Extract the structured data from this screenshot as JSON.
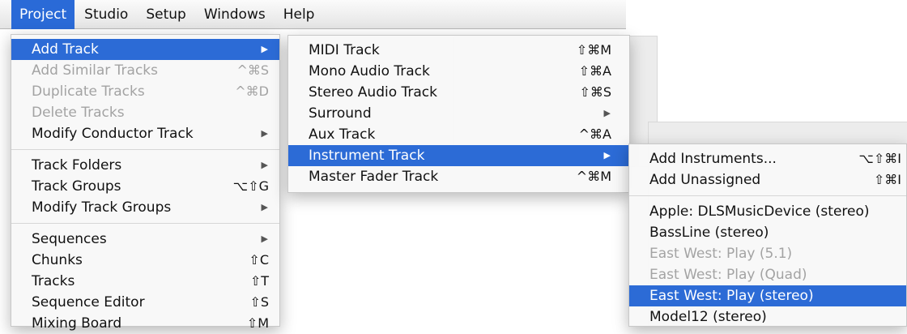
{
  "menubar": {
    "items": [
      "Project",
      "Studio",
      "Setup",
      "Windows",
      "Help"
    ]
  },
  "project_menu": {
    "items": [
      {
        "label": "Add Track",
        "shortcut": "",
        "submenu": true,
        "disabled": false,
        "selected": true
      },
      {
        "label": "Add Similar Tracks",
        "shortcut": "^⌘S",
        "submenu": false,
        "disabled": true,
        "selected": false
      },
      {
        "label": "Duplicate Tracks",
        "shortcut": "^⌘D",
        "submenu": false,
        "disabled": true,
        "selected": false
      },
      {
        "label": "Delete Tracks",
        "shortcut": "",
        "submenu": false,
        "disabled": true,
        "selected": false
      },
      {
        "label": "Modify Conductor Track",
        "shortcut": "",
        "submenu": true,
        "disabled": false,
        "selected": false
      },
      {
        "separator": true
      },
      {
        "label": "Track Folders",
        "shortcut": "",
        "submenu": true,
        "disabled": false,
        "selected": false
      },
      {
        "label": "Track Groups",
        "shortcut": "⌥⇧G",
        "submenu": false,
        "disabled": false,
        "selected": false
      },
      {
        "label": "Modify Track Groups",
        "shortcut": "",
        "submenu": true,
        "disabled": false,
        "selected": false
      },
      {
        "separator": true
      },
      {
        "label": "Sequences",
        "shortcut": "",
        "submenu": true,
        "disabled": false,
        "selected": false
      },
      {
        "label": "Chunks",
        "shortcut": "⇧C",
        "submenu": false,
        "disabled": false,
        "selected": false
      },
      {
        "label": "Tracks",
        "shortcut": "⇧T",
        "submenu": false,
        "disabled": false,
        "selected": false
      },
      {
        "label": "Sequence Editor",
        "shortcut": "⇧S",
        "submenu": false,
        "disabled": false,
        "selected": false
      },
      {
        "label": "Mixing Board",
        "shortcut": "⇧M",
        "submenu": false,
        "disabled": false,
        "selected": false
      }
    ]
  },
  "add_track_menu": {
    "items": [
      {
        "label": "MIDI Track",
        "shortcut": "⇧⌘M",
        "submenu": false,
        "disabled": false,
        "selected": false
      },
      {
        "label": "Mono Audio Track",
        "shortcut": "⇧⌘A",
        "submenu": false,
        "disabled": false,
        "selected": false
      },
      {
        "label": "Stereo Audio Track",
        "shortcut": "⇧⌘S",
        "submenu": false,
        "disabled": false,
        "selected": false
      },
      {
        "label": "Surround",
        "shortcut": "",
        "submenu": true,
        "disabled": false,
        "selected": false
      },
      {
        "label": "Aux Track",
        "shortcut": "^⌘A",
        "submenu": false,
        "disabled": false,
        "selected": false
      },
      {
        "label": "Instrument Track",
        "shortcut": "",
        "submenu": true,
        "disabled": false,
        "selected": true
      },
      {
        "label": "Master Fader Track",
        "shortcut": "^⌘M",
        "submenu": false,
        "disabled": false,
        "selected": false
      }
    ]
  },
  "instrument_menu": {
    "items": [
      {
        "label": "Add Instruments...",
        "shortcut": "⌥⇧⌘I",
        "disabled": false,
        "selected": false
      },
      {
        "label": "Add Unassigned",
        "shortcut": "⇧⌘I",
        "disabled": false,
        "selected": false
      },
      {
        "separator": true
      },
      {
        "label": "Apple: DLSMusicDevice (stereo)",
        "shortcut": "",
        "disabled": false,
        "selected": false
      },
      {
        "label": "BassLine (stereo)",
        "shortcut": "",
        "disabled": false,
        "selected": false
      },
      {
        "label": "East West: Play (5.1)",
        "shortcut": "",
        "disabled": true,
        "selected": false
      },
      {
        "label": "East West: Play (Quad)",
        "shortcut": "",
        "disabled": true,
        "selected": false
      },
      {
        "label": "East West: Play (stereo)",
        "shortcut": "",
        "disabled": false,
        "selected": true
      },
      {
        "label": "Model12 (stereo)",
        "shortcut": "",
        "disabled": false,
        "selected": false
      }
    ]
  },
  "icons": {
    "submenu_arrow": "triangle-right-icon"
  },
  "colors": {
    "selection": "#2c6bd6",
    "disabled_text": "#a3a3a3"
  }
}
